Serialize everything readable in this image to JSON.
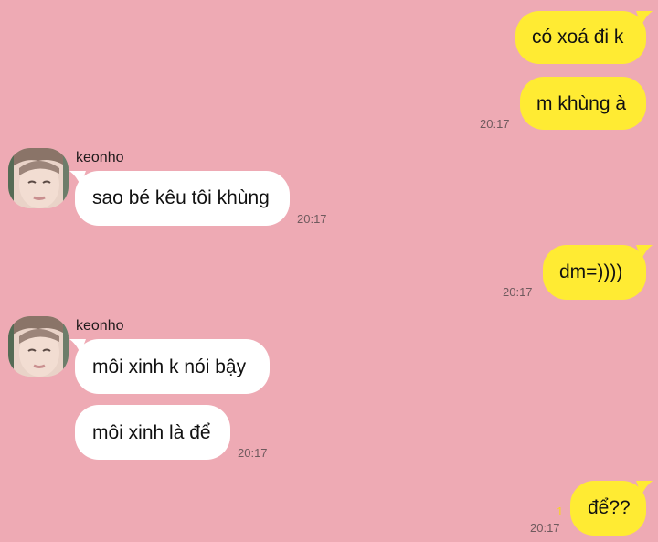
{
  "colors": {
    "background": "#eeaab4",
    "my_bubble": "#ffeb33",
    "their_bubble": "#ffffff"
  },
  "messages": {
    "m1": {
      "text": "có xoá đi k"
    },
    "m2": {
      "text": "m khùng à",
      "time": "20:17"
    },
    "m3": {
      "sender": "keonho",
      "text": "sao bé kêu tôi khùng",
      "time": "20:17"
    },
    "m4": {
      "text": "dm=))))",
      "time": "20:17"
    },
    "m5": {
      "sender": "keonho",
      "text": "môi xinh k nói bậy"
    },
    "m6": {
      "text": "môi xinh là để",
      "time": "20:17"
    },
    "m7": {
      "text": "để??",
      "time": "20:17",
      "unread": "1"
    }
  }
}
